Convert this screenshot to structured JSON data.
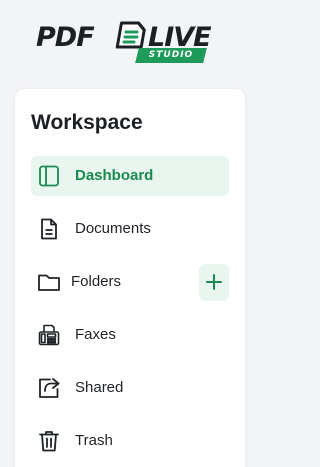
{
  "brand": {
    "word_left": "PDF",
    "word_right": "LIVE",
    "tagline": "STUDIO",
    "accent": "#1e9b5a"
  },
  "workspace": {
    "title": "Workspace",
    "items": [
      {
        "label": "Dashboard",
        "icon": "sidebar-panel-icon",
        "active": true
      },
      {
        "label": "Documents",
        "icon": "document-icon",
        "active": false
      },
      {
        "label": "Folders",
        "icon": "folder-icon",
        "active": false
      },
      {
        "label": "Faxes",
        "icon": "fax-icon",
        "active": false
      },
      {
        "label": "Shared",
        "icon": "share-icon",
        "active": false
      },
      {
        "label": "Trash",
        "icon": "trash-icon",
        "active": false
      }
    ],
    "add_folder_icon": "plus-icon"
  }
}
